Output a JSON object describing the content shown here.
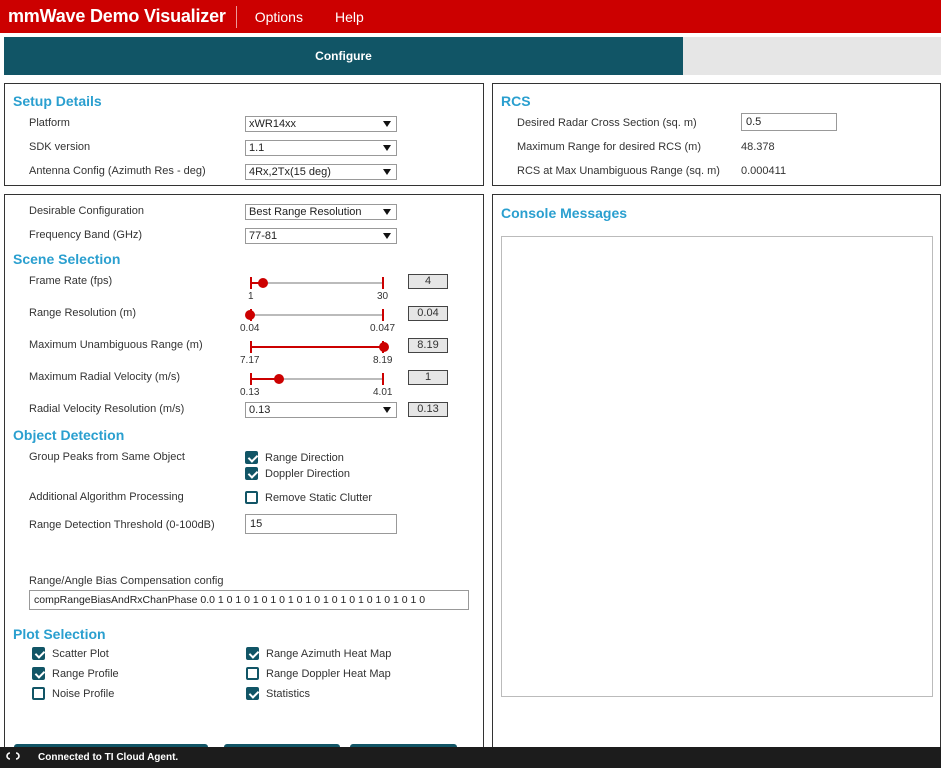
{
  "app": {
    "title": "mmWave Demo Visualizer"
  },
  "menu": {
    "options": "Options",
    "help": "Help"
  },
  "tabs": {
    "configure": "Configure"
  },
  "setup": {
    "title": "Setup Details",
    "platform_label": "Platform",
    "platform_value": "xWR14xx",
    "sdk_label": "SDK version",
    "sdk_value": "1.1",
    "antenna_label": "Antenna Config (Azimuth Res - deg)",
    "antenna_value": "4Rx,2Tx(15 deg)"
  },
  "rcs": {
    "title": "RCS",
    "desired_label": "Desired Radar Cross Section (sq. m)",
    "desired_value": "0.5",
    "maxrange_label": "Maximum Range for desired RCS (m)",
    "maxrange_value": "48.378",
    "unamb_label": "RCS at Max Unambiguous Range (sq. m)",
    "unamb_value": "0.000411"
  },
  "config": {
    "desirable_label": "Desirable Configuration",
    "desirable_value": "Best Range Resolution",
    "band_label": "Frequency Band (GHz)",
    "band_value": "77-81"
  },
  "scene": {
    "title": "Scene Selection",
    "sliders": [
      {
        "label": "Frame Rate (fps)",
        "min": "1",
        "max": "30",
        "value": "4",
        "fraction": 0.1
      },
      {
        "label": "Range Resolution (m)",
        "min": "0.04",
        "max": "0.047",
        "value": "0.04",
        "fraction": 0.0
      },
      {
        "label": "Maximum Unambiguous Range (m)",
        "min": "7.17",
        "max": "8.19",
        "value": "8.19",
        "fraction": 1.0
      },
      {
        "label": "Maximum Radial Velocity (m/s)",
        "min": "0.13",
        "max": "4.01",
        "value": "1",
        "fraction": 0.22
      }
    ],
    "velres_label": "Radial Velocity Resolution (m/s)",
    "velres_select": "0.13",
    "velres_value": "0.13"
  },
  "object": {
    "title": "Object Detection",
    "group_label": "Group Peaks from Same Object",
    "range_dir": "Range Direction",
    "range_dir_checked": true,
    "doppler_dir": "Doppler Direction",
    "doppler_dir_checked": true,
    "algo_label": "Additional Algorithm Processing",
    "static_clutter": "Remove Static Clutter",
    "static_clutter_checked": false,
    "threshold_label": "Range Detection Threshold (0-100dB)",
    "threshold_value": "15",
    "bias_label": "Range/Angle Bias Compensation config",
    "bias_value": "compRangeBiasAndRxChanPhase 0.0 1 0 1 0 1 0 1 0 1 0 1 0 1 0 1 0 1 0 1 0 1 0 1 0"
  },
  "plot": {
    "title": "Plot Selection",
    "scatter": "Scatter Plot",
    "scatter_checked": true,
    "range_profile": "Range Profile",
    "range_profile_checked": true,
    "noise_profile": "Noise Profile",
    "noise_profile_checked": false,
    "azimuth_heat": "Range Azimuth Heat Map",
    "azimuth_heat_checked": true,
    "doppler_heat": "Range Doppler Heat Map",
    "doppler_heat_checked": false,
    "statistics": "Statistics",
    "statistics_checked": true
  },
  "console": {
    "title": "Console Messages"
  },
  "status": {
    "text": "Connected to TI Cloud Agent."
  },
  "colors": {
    "brand": "#cc0000",
    "accent": "#115566",
    "section": "#2a9fcf"
  }
}
